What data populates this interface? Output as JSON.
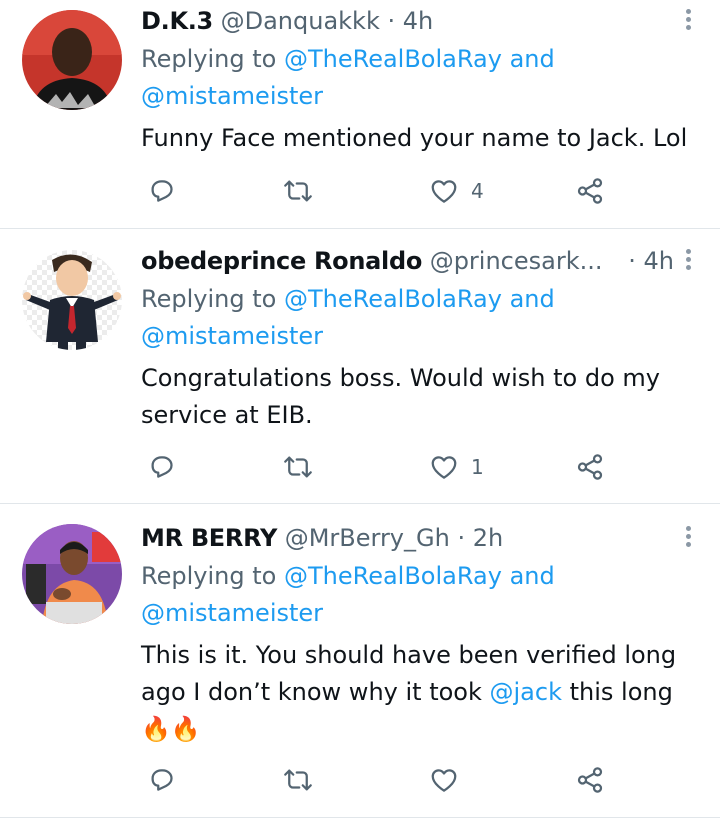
{
  "tweets": [
    {
      "name": "D.K.3",
      "handle": "@Danquakkk",
      "dot": "·",
      "time": "4h",
      "replying_prefix": "Replying to",
      "mention1": "@TheRealBolaRay",
      "and": "and",
      "mention2": "@mistameister",
      "body": "Funny Face mentioned your name to Jack. Lol",
      "likes": "4"
    },
    {
      "name": "obedeprince Ronaldo",
      "handle": "@princesark...",
      "dot": "·",
      "time": "4h",
      "replying_prefix": "Replying to",
      "mention1": "@TheRealBolaRay",
      "and": "and",
      "mention2": "@mistameister",
      "body_line1": "Congratulations boss. Would wish to do my",
      "body_line2": "service at EIB.",
      "likes": "1"
    },
    {
      "name": "MR BERRY",
      "handle": "@MrBerry_Gh",
      "dot": "·",
      "time": "2h",
      "replying_prefix": "Replying to",
      "mention1": "@TheRealBolaRay",
      "and": "and",
      "mention2": "@mistameister",
      "body_line1": "This is it. You should have been verified long",
      "body_line2_pre": "ago I don’t know why it took",
      "body_line2_mention": "@jack",
      "body_line2_post": "this long",
      "body_emoji": "🔥🔥",
      "likes": ""
    }
  ],
  "icons": {
    "reply": "reply-icon",
    "retweet": "retweet-icon",
    "like": "like-icon",
    "share": "share-icon",
    "more": "more-icon"
  },
  "colors": {
    "link": "#1d9bf0",
    "secondary_text": "#536471",
    "icon": "#536471",
    "divider": "#e1e6ea"
  }
}
